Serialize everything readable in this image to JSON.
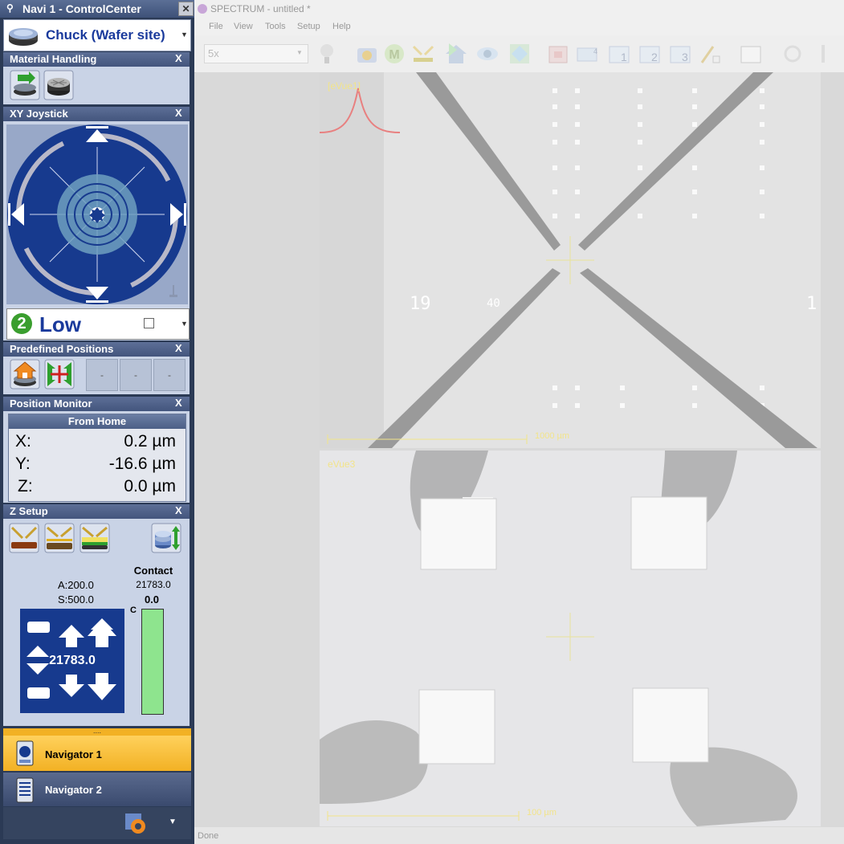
{
  "control_center": {
    "title": "Navi 1 - ControlCenter",
    "close": "✕",
    "chuck_selector": {
      "label": "Chuck (Wafer site)"
    },
    "panels": {
      "material_handling": {
        "title": "Material Handling",
        "close": "X"
      },
      "xy_joystick": {
        "title": "XY Joystick",
        "close": "X"
      },
      "predefined_positions": {
        "title": "Predefined Positions",
        "close": "X",
        "slots": [
          "-",
          "-",
          "-"
        ]
      },
      "position_monitor": {
        "title": "Position Monitor",
        "close": "X",
        "reference": "From Home",
        "rows": [
          {
            "axis": "X:",
            "value": "0.2 µm"
          },
          {
            "axis": "Y:",
            "value": "-16.6 µm"
          },
          {
            "axis": "Z:",
            "value": "0.0 µm"
          }
        ]
      },
      "z_setup": {
        "title": "Z Setup",
        "close": "X",
        "a_label": "A:",
        "a_value": "200.0",
        "s_label": "S:",
        "s_value": "500.0",
        "contact_label": "Contact",
        "contact_value": "21783.0",
        "offset_value": "0.0",
        "bar_label": "C",
        "pad_value": "21783.0",
        "contact_fill_fraction": 1.0
      }
    },
    "speed": {
      "level": "2",
      "label": "Low"
    },
    "navigator": {
      "splitter": "....",
      "items": [
        {
          "label": "Navigator 1",
          "active": true
        },
        {
          "label": "Navigator 2",
          "active": false
        }
      ]
    }
  },
  "spectrum": {
    "title": "SPECTRUM - untitled *",
    "menu": [
      "File",
      "View",
      "Tools",
      "Setup",
      "Help"
    ],
    "zoom_value": "5x",
    "views": [
      {
        "label": "[eVue1]",
        "scale": "1000 µm",
        "die_labels": [
          "19",
          "40",
          "1"
        ]
      },
      {
        "label": "eVue3",
        "scale": "100 µm"
      }
    ],
    "status": "Done"
  },
  "colors": {
    "panel_header": "#4c5f86",
    "accent_text": "#1a3a9c",
    "nav_active": "#f2b124",
    "joystick_blue": "#173a8e",
    "contact_bar": "#8ee48e"
  }
}
